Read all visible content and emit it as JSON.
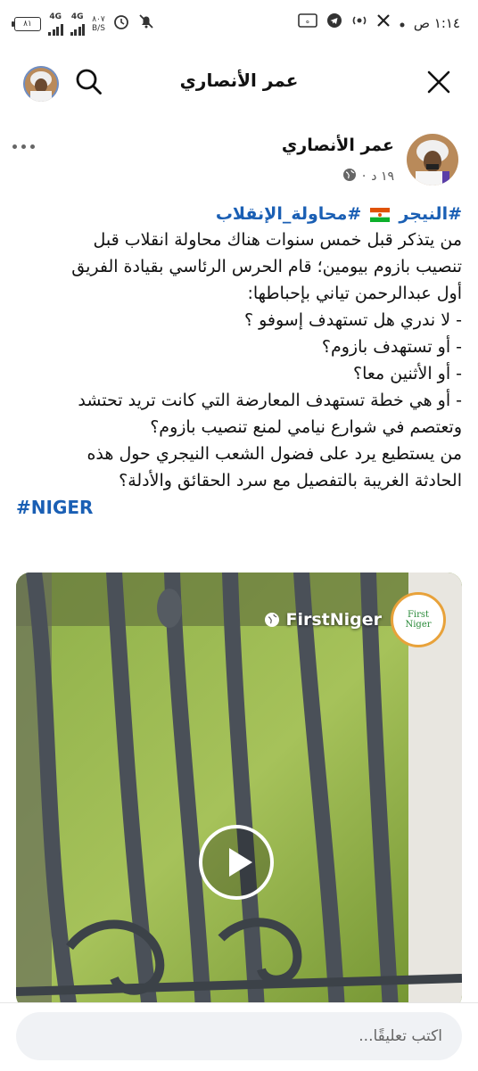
{
  "status_bar": {
    "time": "١:١٤ ص",
    "battery": "٨١",
    "network_1": "4G",
    "network_2": "4G",
    "speed_value": "٨٠٧",
    "speed_unit": "B/S",
    "icons": [
      "clock-alarm-icon",
      "notifications-off-icon",
      "x-app-icon",
      "radio-icon",
      "telegram-icon",
      "app-badge-icon"
    ]
  },
  "header": {
    "title": "عمر الأنصاري"
  },
  "post": {
    "author": "عمر الأنصاري",
    "time": "١٩ د",
    "separator": "·",
    "hashtag_1": "#النيجر",
    "hashtag_2": "#محاولة_الإنقلاب",
    "lines": [
      "من يتذكر قبل خمس سنوات هناك محاولة انقلاب قبل",
      "تنصيب بازوم بيومين؛ قام الحرس الرئاسي بقيادة الفريق",
      "أول عبدالرحمن تياني بإحباطها:",
      "- لا ندري هل تستهدف إسوفو ؟",
      "- أو تستهدف بازوم؟",
      "- أو الأثنين معا؟",
      "- أو هي خطة تستهدف المعارضة التي كانت تريد تحتشد",
      "وتعتصم في شوارع نيامي لمنع تنصيب بازوم؟",
      "من يستطيع يرد على فضول الشعب النيجري حول هذه",
      "الحادثة الغريبة بالتفصيل مع سرد الحقائق والأدلة؟"
    ],
    "hashtag_niger": "#NIGER"
  },
  "video": {
    "source_name": "FirstNiger",
    "logo_text": "First Niger"
  },
  "comment": {
    "placeholder": "اكتب تعليقًا..."
  },
  "colors": {
    "hashtag": "#1a5fb4",
    "video_bg": "#7fa03a"
  }
}
